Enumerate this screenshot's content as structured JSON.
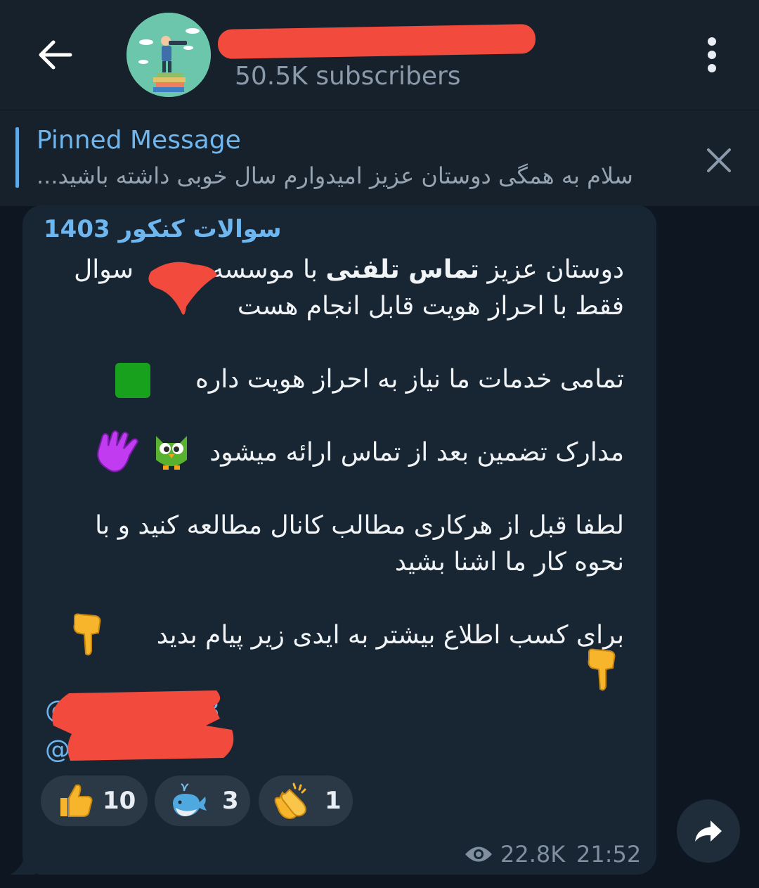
{
  "header": {
    "subscribers": "50.5K subscribers"
  },
  "pinned": {
    "title": "Pinned Message",
    "text": "سلام به همگی دوستان عزیز امیدوارم سال خوبی داشته باشید..."
  },
  "message": {
    "author": "سوالات کنکور 1403",
    "line1a": "دوستان عزیز ",
    "line1b": "تماس تلفنی",
    "line1c": " با موسسه",
    "line1d": "سوال",
    "line2": "فقط با احراز هویت قابل انجام هست",
    "line3": "تمامی خدمات ما نیاز به احراز هویت داره",
    "line4": "مدارک تضمین بعد از تماس ارائه میشود",
    "line5": "لطفا قبل از هرکاری مطالب کانال مطالعه کنید و با",
    "line6": "نحوه کار ما اشنا بشید",
    "line7": "برای کسب اطلاع بیشتر به ایدی زیر پیام بدید",
    "handle1_start": "@",
    "handle1_end": "3",
    "handle2_start": "@"
  },
  "reactions": [
    {
      "icon": "thumbs-up-icon",
      "count": "10"
    },
    {
      "icon": "whale-icon",
      "count": "3"
    },
    {
      "icon": "clapping-hands-icon",
      "count": "1"
    }
  ],
  "meta": {
    "views": "22.8K",
    "time": "21:52"
  },
  "colors": {
    "background": "#0e1621",
    "header": "#17212b",
    "bubble": "#182533",
    "accent": "#6db6f0",
    "redaction": "#f24a3c"
  }
}
